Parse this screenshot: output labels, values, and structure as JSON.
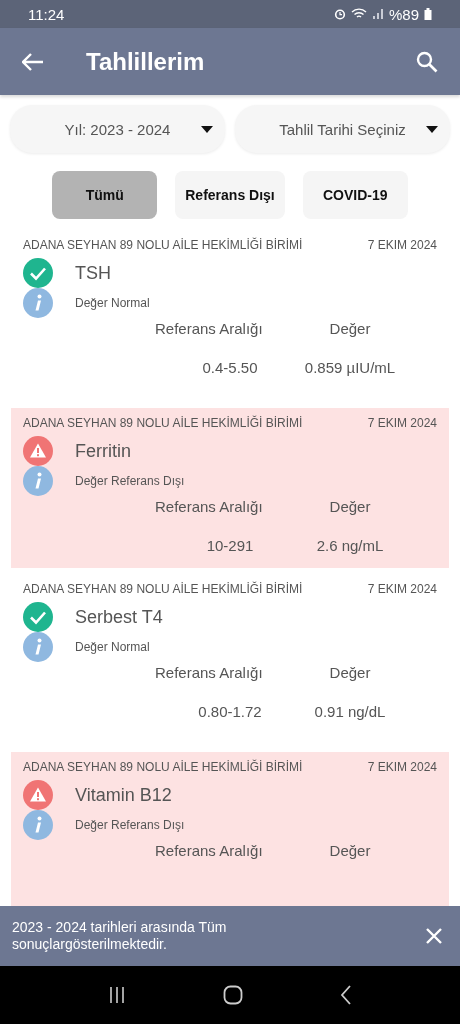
{
  "status_bar": {
    "time": "11:24",
    "battery": "%89"
  },
  "app_bar": {
    "title": "Tahlillerim"
  },
  "filters": [
    {
      "label": "Yıl: 2023 - 2024"
    },
    {
      "label": "Tahlil Tarihi Seçiniz"
    }
  ],
  "chips": [
    {
      "label": "Tümü",
      "selected": true
    },
    {
      "label": "Referans Dışı",
      "selected": false
    },
    {
      "label": "COVID-19",
      "selected": false
    }
  ],
  "results": [
    {
      "facility": "ADANA SEYHAN 89 NOLU AİLE HEKİMLİĞİ BİRİMİ",
      "date": "7 EKIM 2024",
      "test": "TSH",
      "out_of_range": false,
      "status_text": "Değer Normal",
      "range_label": "Referans Aralığı",
      "value_label": "Değer",
      "range": "0.4-5.50",
      "value": "0.859 µIU/mL"
    },
    {
      "facility": "ADANA SEYHAN 89 NOLU AİLE HEKİMLİĞİ BİRİMİ",
      "date": "7 EKIM 2024",
      "test": "Ferritin",
      "out_of_range": true,
      "status_text": "Değer Referans Dışı",
      "range_label": "Referans Aralığı",
      "value_label": "Değer",
      "range": "10-291",
      "value": "2.6 ng/mL"
    },
    {
      "facility": "ADANA SEYHAN 89 NOLU AİLE HEKİMLİĞİ BİRİMİ",
      "date": "7 EKIM 2024",
      "test": "Serbest T4",
      "out_of_range": false,
      "status_text": "Değer Normal",
      "range_label": "Referans Aralığı",
      "value_label": "Değer",
      "range": "0.80-1.72",
      "value": "0.91 ng/dL"
    },
    {
      "facility": "ADANA SEYHAN 89 NOLU AİLE HEKİMLİĞİ BİRİMİ",
      "date": "7 EKIM 2024",
      "test": "Vitamin B12",
      "out_of_range": true,
      "status_text": "Değer Referans Dışı",
      "range_label": "Referans Aralığı",
      "value_label": "Değer"
    }
  ],
  "snackbar": {
    "message": "2023 - 2024 tarihleri arasında Tüm sonuçlargösterilmektedir."
  }
}
